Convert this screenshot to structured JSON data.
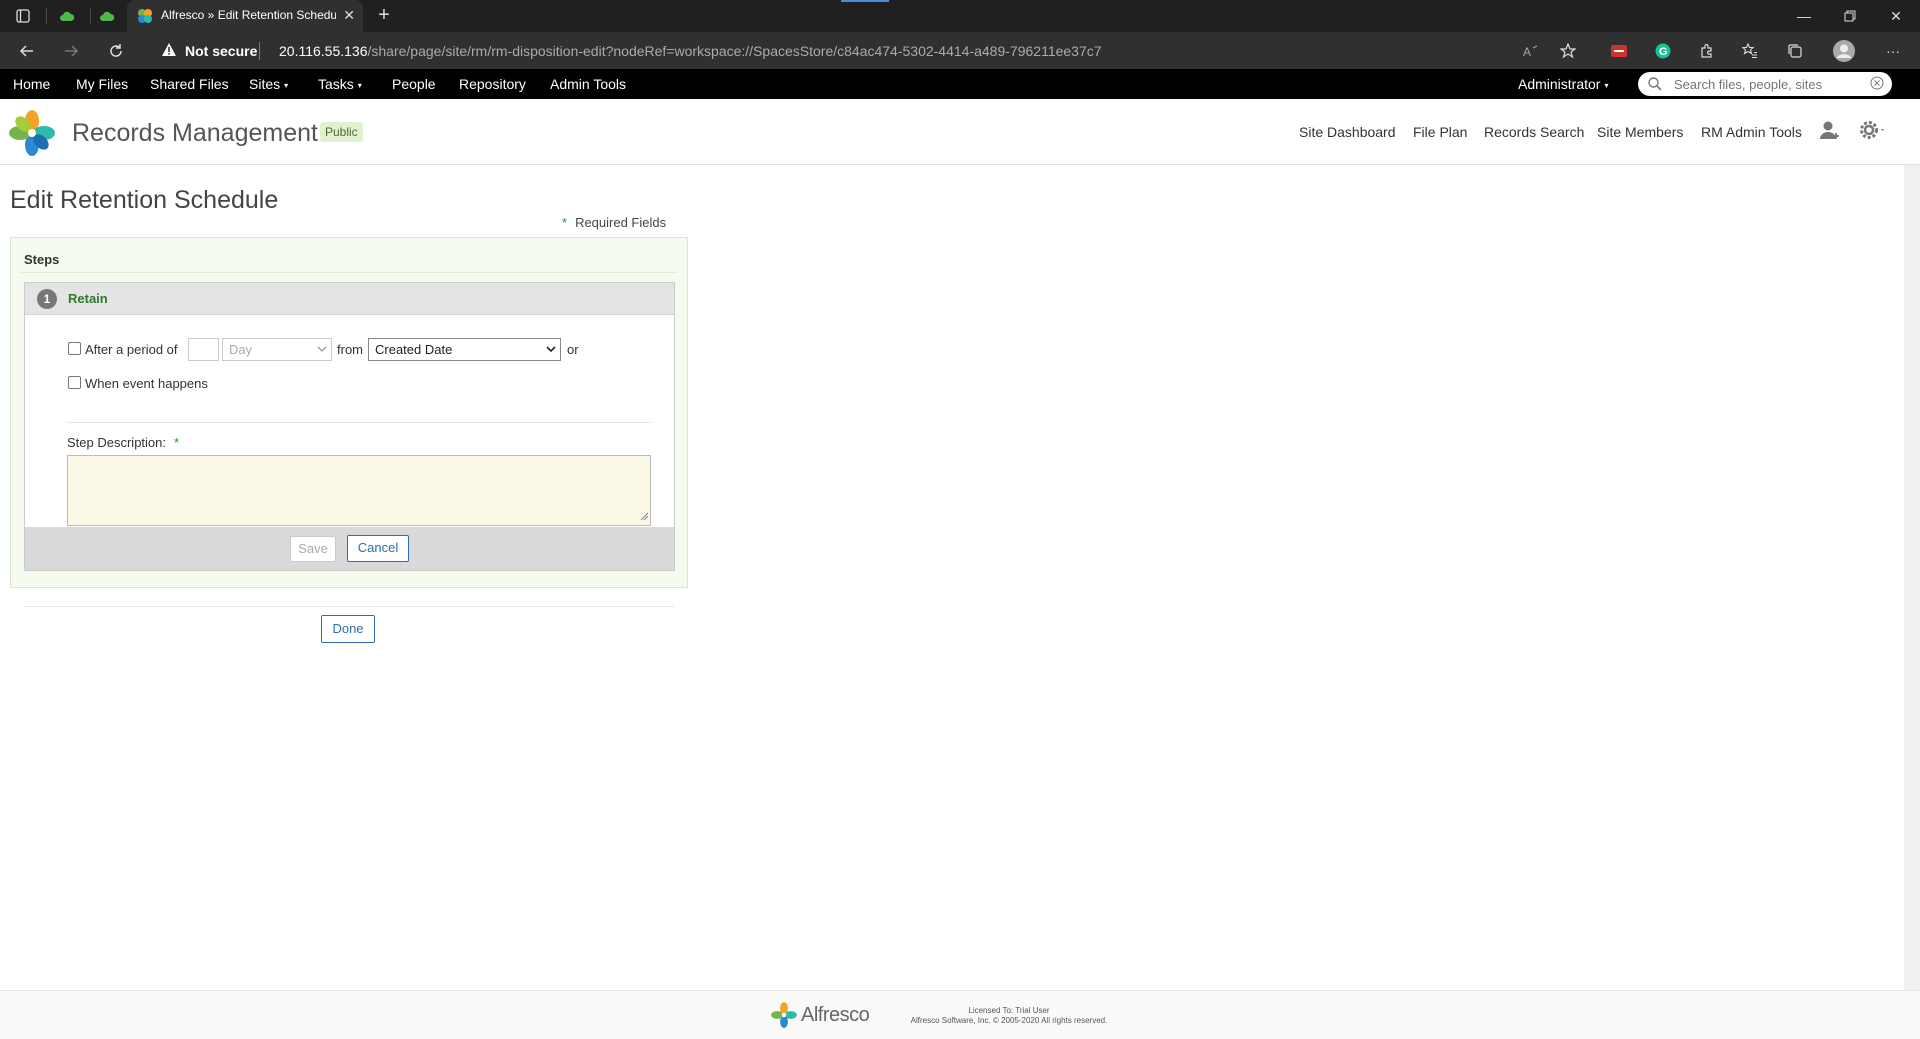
{
  "browser": {
    "tab_title": "Alfresco » Edit Retention Schedule",
    "security_label": "Not secure",
    "url_host": "20.116.55.136",
    "url_path": "/share/page/site/rm/rm-disposition-edit?nodeRef=workspace://SpacesStore/c84ac474-5302-4414-a489-796211ee37c7"
  },
  "app_nav": {
    "items": [
      "Home",
      "My Files",
      "Shared Files",
      "Sites",
      "Tasks",
      "People",
      "Repository",
      "Admin Tools"
    ],
    "user": "Administrator",
    "search_placeholder": "Search files, people, sites"
  },
  "site": {
    "title": "Records Management",
    "visibility": "Public",
    "links": [
      "Site Dashboard",
      "File Plan",
      "Records Search",
      "Site Members",
      "RM Admin Tools"
    ]
  },
  "page": {
    "title": "Edit Retention Schedule",
    "required_star": "*",
    "required_label": "Required Fields",
    "steps_header": "Steps",
    "step": {
      "number": "1",
      "name": "Retain",
      "after_period_label": "After a period of",
      "period_value": "",
      "period_unit": "Day",
      "from_label": "from",
      "from_value": "Created Date",
      "or_label": "or",
      "event_label": "When event happens",
      "description_label": "Step Description:",
      "description_value": "",
      "save_label": "Save",
      "cancel_label": "Cancel"
    },
    "done_label": "Done"
  },
  "footer": {
    "brand": "Alfresco",
    "license_line1": "Licensed To: Trial User",
    "license_line2": "Alfresco Software, Inc. © 2005-2020 All rights reserved."
  },
  "colors": {
    "accent_green": "#2a7d2a",
    "button_blue": "#2f6da6",
    "nav_bg": "#000000",
    "description_bg": "#fbf9e6"
  }
}
